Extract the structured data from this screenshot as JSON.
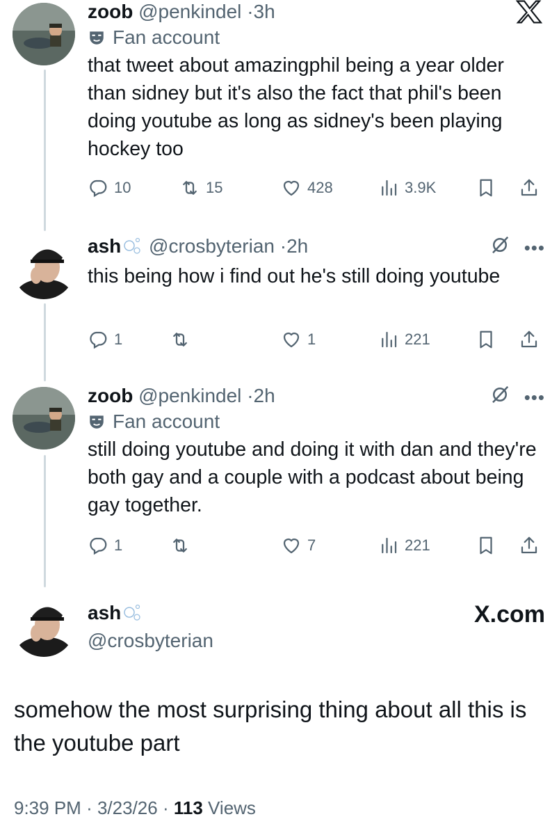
{
  "tweets": [
    {
      "name": "zoob",
      "handle": "@penkindel",
      "time": "3h",
      "badge": "Fan account",
      "text": "that tweet about amazingphil being a year older than sidney but it's also the fact that phil's been doing youtube as long as sidney's been playing hockey too",
      "replies": "10",
      "reposts": "15",
      "likes": "428",
      "views": "3.9K"
    },
    {
      "name": "ash",
      "handle": "@crosbyterian",
      "time": "2h",
      "text": "this being how i find out he's still doing youtube",
      "replies": "1",
      "reposts": "",
      "likes": "1",
      "views": "221"
    },
    {
      "name": "zoob",
      "handle": "@penkindel",
      "time": "2h",
      "badge": "Fan account",
      "text": "still doing youtube and doing it with dan and they're both gay and a couple with a podcast about being gay together.",
      "replies": "1",
      "reposts": "",
      "likes": "7",
      "views": "221"
    }
  ],
  "main": {
    "name": "ash",
    "handle": "@crosbyterian",
    "text": "somehow the most surprising thing about all this is the youtube part",
    "time": "9:39 PM",
    "date": "3/23/26",
    "views_count": "113",
    "views_label": "Views",
    "brand": "X.com"
  },
  "separator": "·",
  "icons": [
    "x-logo-icon",
    "mask-icon",
    "reply-icon",
    "repost-icon",
    "like-icon",
    "views-icon",
    "bookmark-icon",
    "share-icon",
    "grok-icon",
    "more-icon",
    "bubbles-icon"
  ]
}
